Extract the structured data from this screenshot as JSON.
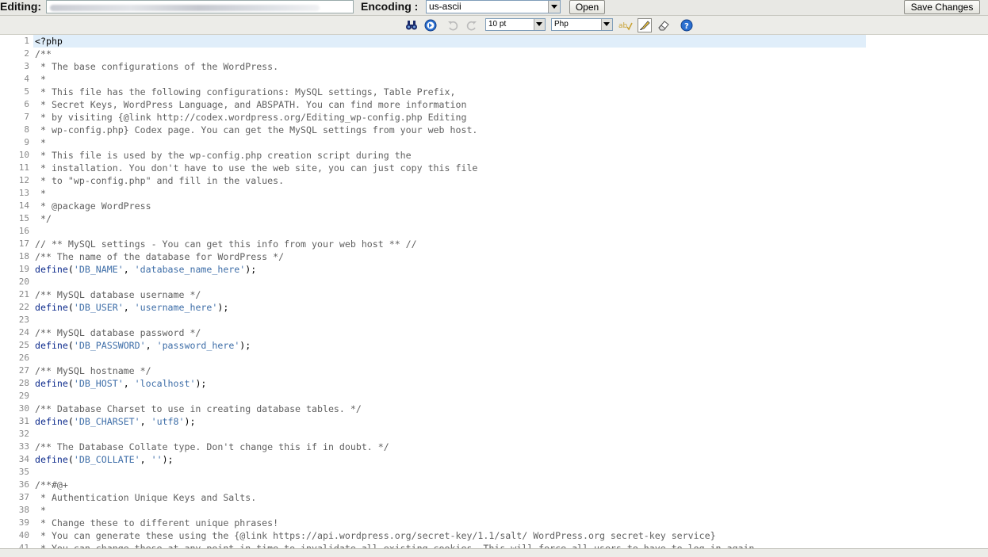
{
  "header": {
    "editing_label": "Editing:",
    "encoding_label": "Encoding :",
    "encoding_value": "us-ascii",
    "open_label": "Open",
    "save_label": "Save Changes"
  },
  "toolbar": {
    "font_size": "10 pt",
    "syntax": "Php",
    "icons": [
      "search-icon",
      "goto-line-icon",
      "undo-icon",
      "redo-icon",
      "spellcheck-icon",
      "highlight-icon",
      "eraser-icon",
      "help-icon"
    ]
  },
  "editor": {
    "active_line": 1,
    "lines": [
      {
        "n": "1",
        "s": [
          {
            "t": "<?php",
            "c": "php"
          }
        ]
      },
      {
        "n": "2",
        "s": [
          {
            "t": "/**",
            "c": "cm"
          }
        ]
      },
      {
        "n": "3",
        "s": [
          {
            "t": " * The base configurations of the WordPress.",
            "c": "cm"
          }
        ]
      },
      {
        "n": "4",
        "s": [
          {
            "t": " *",
            "c": "cm"
          }
        ]
      },
      {
        "n": "5",
        "s": [
          {
            "t": " * This file has the following configurations: MySQL settings, Table Prefix,",
            "c": "cm"
          }
        ]
      },
      {
        "n": "6",
        "s": [
          {
            "t": " * Secret Keys, WordPress Language, and ABSPATH. You can find more information",
            "c": "cm"
          }
        ]
      },
      {
        "n": "7",
        "s": [
          {
            "t": " * by visiting {@link http://codex.wordpress.org/Editing_wp-config.php Editing",
            "c": "cm"
          }
        ]
      },
      {
        "n": "8",
        "s": [
          {
            "t": " * wp-config.php} Codex page. You can get the MySQL settings from your web host.",
            "c": "cm"
          }
        ]
      },
      {
        "n": "9",
        "s": [
          {
            "t": " *",
            "c": "cm"
          }
        ]
      },
      {
        "n": "10",
        "s": [
          {
            "t": " * This file is used by the wp-config.php creation script during the",
            "c": "cm"
          }
        ]
      },
      {
        "n": "11",
        "s": [
          {
            "t": " * installation. You don't have to use the web site, you can just copy this file",
            "c": "cm"
          }
        ]
      },
      {
        "n": "12",
        "s": [
          {
            "t": " * to \"wp-config.php\" and fill in the values.",
            "c": "cm"
          }
        ]
      },
      {
        "n": "13",
        "s": [
          {
            "t": " *",
            "c": "cm"
          }
        ]
      },
      {
        "n": "14",
        "s": [
          {
            "t": " * @package WordPress",
            "c": "cm"
          }
        ]
      },
      {
        "n": "15",
        "s": [
          {
            "t": " */",
            "c": "cm"
          }
        ]
      },
      {
        "n": "16",
        "s": []
      },
      {
        "n": "17",
        "s": [
          {
            "t": "// ** MySQL settings - You can get this info from your web host ** //",
            "c": "cm"
          }
        ]
      },
      {
        "n": "18",
        "s": [
          {
            "t": "/** The name of the database for WordPress */",
            "c": "cm"
          }
        ]
      },
      {
        "n": "19",
        "s": [
          {
            "t": "define",
            "c": "kw"
          },
          {
            "t": "(",
            "c": ""
          },
          {
            "t": "'DB_NAME'",
            "c": "st"
          },
          {
            "t": ", ",
            "c": ""
          },
          {
            "t": "'database_name_here'",
            "c": "st"
          },
          {
            "t": ");",
            "c": ""
          }
        ]
      },
      {
        "n": "20",
        "s": []
      },
      {
        "n": "21",
        "s": [
          {
            "t": "/** MySQL database username */",
            "c": "cm"
          }
        ]
      },
      {
        "n": "22",
        "s": [
          {
            "t": "define",
            "c": "kw"
          },
          {
            "t": "(",
            "c": ""
          },
          {
            "t": "'DB_USER'",
            "c": "st"
          },
          {
            "t": ", ",
            "c": ""
          },
          {
            "t": "'username_here'",
            "c": "st"
          },
          {
            "t": ");",
            "c": ""
          }
        ]
      },
      {
        "n": "23",
        "s": []
      },
      {
        "n": "24",
        "s": [
          {
            "t": "/** MySQL database password */",
            "c": "cm"
          }
        ]
      },
      {
        "n": "25",
        "s": [
          {
            "t": "define",
            "c": "kw"
          },
          {
            "t": "(",
            "c": ""
          },
          {
            "t": "'DB_PASSWORD'",
            "c": "st"
          },
          {
            "t": ", ",
            "c": ""
          },
          {
            "t": "'password_here'",
            "c": "st"
          },
          {
            "t": ");",
            "c": ""
          }
        ]
      },
      {
        "n": "26",
        "s": []
      },
      {
        "n": "27",
        "s": [
          {
            "t": "/** MySQL hostname */",
            "c": "cm"
          }
        ]
      },
      {
        "n": "28",
        "s": [
          {
            "t": "define",
            "c": "kw"
          },
          {
            "t": "(",
            "c": ""
          },
          {
            "t": "'DB_HOST'",
            "c": "st"
          },
          {
            "t": ", ",
            "c": ""
          },
          {
            "t": "'localhost'",
            "c": "st"
          },
          {
            "t": ");",
            "c": ""
          }
        ]
      },
      {
        "n": "29",
        "s": []
      },
      {
        "n": "30",
        "s": [
          {
            "t": "/** Database Charset to use in creating database tables. */",
            "c": "cm"
          }
        ]
      },
      {
        "n": "31",
        "s": [
          {
            "t": "define",
            "c": "kw"
          },
          {
            "t": "(",
            "c": ""
          },
          {
            "t": "'DB_CHARSET'",
            "c": "st"
          },
          {
            "t": ", ",
            "c": ""
          },
          {
            "t": "'utf8'",
            "c": "st"
          },
          {
            "t": ");",
            "c": ""
          }
        ]
      },
      {
        "n": "32",
        "s": []
      },
      {
        "n": "33",
        "s": [
          {
            "t": "/** The Database Collate type. Don't change this if in doubt. */",
            "c": "cm"
          }
        ]
      },
      {
        "n": "34",
        "s": [
          {
            "t": "define",
            "c": "kw"
          },
          {
            "t": "(",
            "c": ""
          },
          {
            "t": "'DB_COLLATE'",
            "c": "st"
          },
          {
            "t": ", ",
            "c": ""
          },
          {
            "t": "''",
            "c": "st"
          },
          {
            "t": ");",
            "c": ""
          }
        ]
      },
      {
        "n": "35",
        "s": []
      },
      {
        "n": "36",
        "s": [
          {
            "t": "/**#@+",
            "c": "cm"
          }
        ]
      },
      {
        "n": "37",
        "s": [
          {
            "t": " * Authentication Unique Keys and Salts.",
            "c": "cm"
          }
        ]
      },
      {
        "n": "38",
        "s": [
          {
            "t": " *",
            "c": "cm"
          }
        ]
      },
      {
        "n": "39",
        "s": [
          {
            "t": " * Change these to different unique phrases!",
            "c": "cm"
          }
        ]
      },
      {
        "n": "40",
        "s": [
          {
            "t": " * You can generate these using the {@link https://api.wordpress.org/secret-key/1.1/salt/ WordPress.org secret-key service}",
            "c": "cm"
          }
        ]
      },
      {
        "n": "41",
        "s": [
          {
            "t": " * You can change these at any point in time to invalidate all existing cookies. This will force all users to have to log in again.",
            "c": "cm"
          }
        ]
      }
    ]
  }
}
